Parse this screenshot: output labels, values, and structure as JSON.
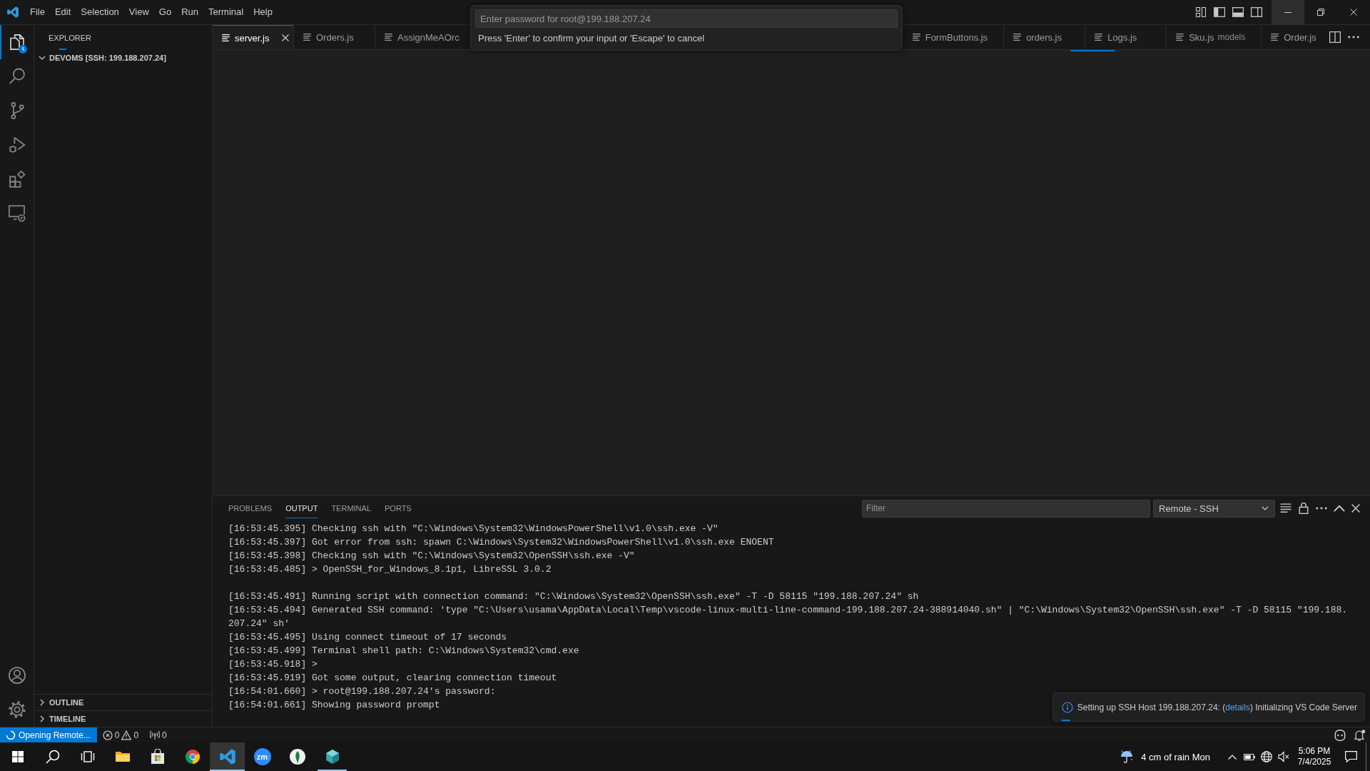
{
  "title_bar": {
    "menu": [
      "File",
      "Edit",
      "Selection",
      "View",
      "Go",
      "Run",
      "Terminal",
      "Help"
    ],
    "window_buttons": [
      {
        "kind": "minimize",
        "hovered": true
      },
      {
        "kind": "restore",
        "hovered": false
      },
      {
        "kind": "close",
        "hovered": false
      }
    ]
  },
  "quick_input": {
    "placeholder": "Enter password for root@199.188.207.24",
    "message": "Press 'Enter' to confirm your input or 'Escape' to cancel"
  },
  "activity_bar": {
    "items": [
      {
        "kind": "explorer",
        "selected": true,
        "busy": true
      },
      {
        "kind": "search",
        "selected": false,
        "busy": false
      },
      {
        "kind": "source-control",
        "selected": false,
        "busy": false
      },
      {
        "kind": "run-debug",
        "selected": false,
        "busy": false
      },
      {
        "kind": "extensions",
        "selected": false,
        "busy": false
      },
      {
        "kind": "remote-explorer",
        "selected": false,
        "busy": false
      }
    ],
    "bottom_items": [
      {
        "kind": "accounts"
      },
      {
        "kind": "manage"
      }
    ]
  },
  "sidebar": {
    "title": "EXPLORER",
    "busy": true,
    "sections": [
      {
        "title": "DEVOMS [SSH: 199.188.207.24]",
        "expanded": true
      },
      {
        "title": "OUTLINE",
        "expanded": false
      },
      {
        "title": "TIMELINE",
        "expanded": false
      }
    ]
  },
  "editor": {
    "busy": true,
    "tabs": [
      {
        "label": "server.js",
        "selected": true
      },
      {
        "label": "Orders.js",
        "selected": false
      },
      {
        "label": "AssignMeAOrc",
        "selected": false
      },
      {
        "label": "FormButtons.js",
        "selected": false
      },
      {
        "label": "orders.js",
        "selected": false
      },
      {
        "label": "Logs.js",
        "selected": false
      },
      {
        "label": "Sku.js",
        "description": "models",
        "selected": false
      },
      {
        "label": "Order.js",
        "selected": false
      }
    ]
  },
  "panel": {
    "tabs": [
      {
        "label": "PROBLEMS",
        "selected": false
      },
      {
        "label": "OUTPUT",
        "selected": true
      },
      {
        "label": "TERMINAL",
        "selected": false
      },
      {
        "label": "PORTS",
        "selected": false
      }
    ],
    "filter": {
      "placeholder": "Filter"
    },
    "channel": "Remote - SSH",
    "output": [
      {
        "lines": [
          "[16:53:45.395] Checking ssh with \"C:\\Windows\\System32\\WindowsPowerShell\\v1.0\\ssh.exe -V\"",
          "[16:53:45.397] Got error from ssh: spawn C:\\Windows\\System32\\WindowsPowerShell\\v1.0\\ssh.exe ENOENT",
          "[16:53:45.398] Checking ssh with \"C:\\Windows\\System32\\OpenSSH\\ssh.exe -V\"",
          "[16:53:45.485] > OpenSSH_for_Windows_8.1p1, LibreSSL 3.0.2"
        ]
      },
      {
        "lines": [
          "[16:53:45.491] Running script with connection command: \"C:\\Windows\\System32\\OpenSSH\\ssh.exe\" -T -D 58115 \"199.188.207.24\" sh",
          "[16:53:45.494] Generated SSH command: 'type \"C:\\Users\\usama\\AppData\\Local\\Temp\\vscode-linux-multi-line-command-199.188.207.24-388914040.sh\" | \"C:\\Windows\\System32\\OpenSSH\\ssh.exe\" -T -D 58115 \"199.188.207.24\" sh'",
          "[16:53:45.495] Using connect timeout of 17 seconds",
          "[16:53:45.499] Terminal shell path: C:\\Windows\\System32\\cmd.exe",
          "[16:53:45.918] >",
          "[16:53:45.919] Got some output, clearing connection timeout",
          "[16:54:01.660] > root@199.188.207.24's password:",
          "[16:54:01.661] Showing password prompt"
        ]
      }
    ]
  },
  "notification": {
    "text_before": "Setting up SSH Host 199.188.207.24: (",
    "link": "details",
    "text_after": ") Initializing VS Code Server",
    "busy": true
  },
  "status_bar": {
    "remote": "Opening Remote...",
    "errors": "0",
    "warnings": "0",
    "ports": "0"
  },
  "taskbar": {
    "apps": [
      {
        "kind": "folder",
        "running": false,
        "active": false
      },
      {
        "kind": "store",
        "running": false,
        "active": false
      },
      {
        "kind": "browser",
        "running": false,
        "active": false
      },
      {
        "kind": "editor",
        "running": true,
        "active": true
      },
      {
        "kind": "meeting",
        "label": "zm",
        "running": false,
        "active": false
      },
      {
        "kind": "leaf",
        "running": false,
        "active": false
      },
      {
        "kind": "cube",
        "running": true,
        "active": false
      }
    ],
    "weather": "4 cm of rain Mon",
    "time": "5:06 PM",
    "date": "7/4/2025"
  }
}
